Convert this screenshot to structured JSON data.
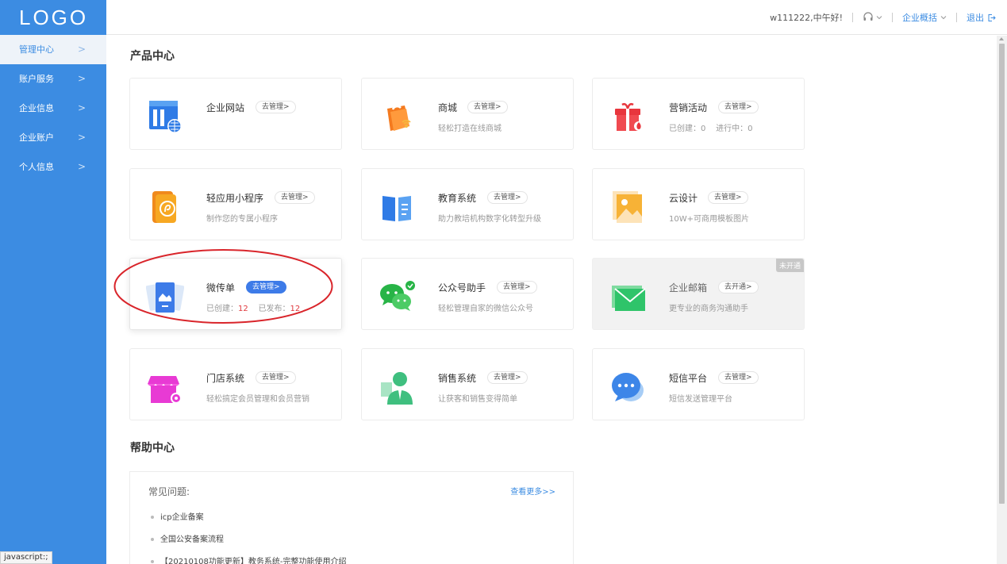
{
  "logo": "LOGO",
  "sidebar": {
    "items": [
      {
        "label": "管理中心",
        "active": true
      },
      {
        "label": "账户服务"
      },
      {
        "label": "企业信息"
      },
      {
        "label": "企业账户"
      },
      {
        "label": "个人信息"
      }
    ]
  },
  "header": {
    "greeting": "w111222,中午好!",
    "support_icon": "headset-icon",
    "overview": "企业概括",
    "logout": "退出"
  },
  "products": {
    "title": "产品中心",
    "cards": [
      {
        "title": "企业网站",
        "button": "去管理>",
        "sub": "",
        "icon": "website-icon"
      },
      {
        "title": "商城",
        "button": "去管理>",
        "sub": "轻松打造在线商城",
        "icon": "shop-bag-icon"
      },
      {
        "title": "营销活动",
        "button": "去管理>",
        "sub_label1": "已创建：",
        "sub_num1": "0",
        "sub_label2": "进行中：",
        "sub_num2": "0",
        "icon": "gift-icon"
      },
      {
        "title": "轻应用小程序",
        "button": "去管理>",
        "sub": "制作您的专属小程序",
        "icon": "mini-program-icon"
      },
      {
        "title": "教育系统",
        "button": "去管理>",
        "sub": "助力教培机构数字化转型升级",
        "icon": "book-icon"
      },
      {
        "title": "云设计",
        "button": "去管理>",
        "sub": "10W+可商用模板图片",
        "icon": "image-icon"
      },
      {
        "title": "微传单",
        "button": "去管理>",
        "sub_label1": "已创建：",
        "sub_num1": "12",
        "sub_label2": "已发布：",
        "sub_num2": "12",
        "icon": "flyer-icon"
      },
      {
        "title": "公众号助手",
        "button": "去管理>",
        "sub": "轻松管理自家的微信公众号",
        "icon": "wechat-icon"
      },
      {
        "title": "企业邮箱",
        "button": "去开通>",
        "sub": "更专业的商务沟通助手",
        "badge": "未开通",
        "icon": "mail-icon"
      },
      {
        "title": "门店系统",
        "button": "去管理>",
        "sub": "轻松搞定会员管理和会员营销",
        "icon": "store-icon"
      },
      {
        "title": "销售系统",
        "button": "去管理>",
        "sub": "让获客和销售变得简单",
        "icon": "salesperson-icon"
      },
      {
        "title": "短信平台",
        "button": "去管理>",
        "sub": "短信发送管理平台",
        "icon": "chat-bubble-icon"
      }
    ]
  },
  "help": {
    "title": "帮助中心",
    "faq_label": "常见问题:",
    "more": "查看更多>>",
    "items": [
      "icp企业备案",
      "全国公安备案流程",
      "【20210108功能更新】教务系统-完整功能使用介绍"
    ]
  },
  "status_bar": "javascript:;"
}
